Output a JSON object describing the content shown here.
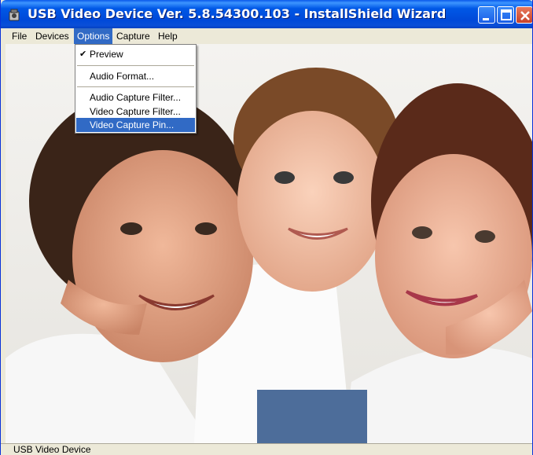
{
  "window": {
    "title": "USB Video Device Ver. 5.8.54300.103 - InstallShield Wizard"
  },
  "menubar": {
    "items": [
      "File",
      "Devices",
      "Options",
      "Capture",
      "Help"
    ]
  },
  "options_menu": {
    "items": [
      {
        "label": "Preview",
        "checked": true
      },
      {
        "label": "Audio Format..."
      },
      {
        "label": "Audio Capture Filter..."
      },
      {
        "label": "Video Capture Filter..."
      },
      {
        "label": "Video Capture Pin...",
        "highlighted": true
      }
    ]
  },
  "statusbar": {
    "text": "USB Video Device"
  },
  "preview": {
    "content": "webcam-preview-image"
  },
  "colors": {
    "titlebar": "#0054e3",
    "menu_highlight": "#316ac5",
    "window_bg": "#ece9d8",
    "close_button": "#d8553a"
  }
}
